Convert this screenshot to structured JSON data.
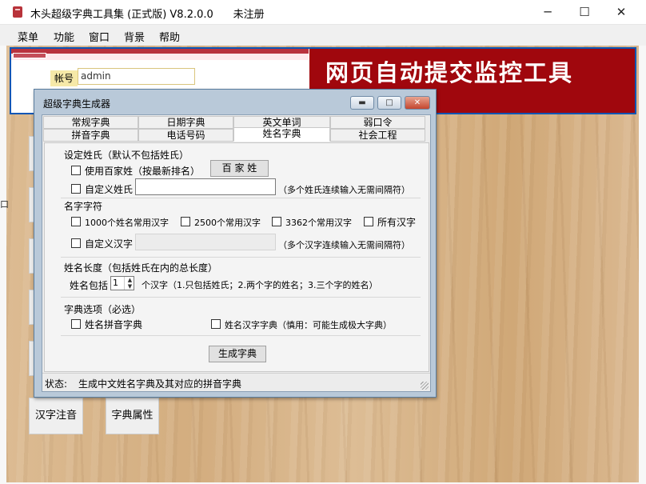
{
  "window": {
    "title": "木头超级字典工具集 (正式版) V8.2.0.0      未注册",
    "minimize": "─",
    "maximize": "☐",
    "close": "✕"
  },
  "menu": [
    "菜单",
    "功能",
    "窗口",
    "背景",
    "帮助"
  ],
  "web_preview": {
    "account_label": "帐号",
    "account_value": "admin",
    "banner_text": "网页自动提交监控工具"
  },
  "bottom_buttons": [
    "汉字注音",
    "字典属性"
  ],
  "edge_glyph": "口",
  "dialog": {
    "title": "超级字典生成器",
    "controls": {
      "minimize": "▬",
      "maximize": "□",
      "close": "✕"
    },
    "tabs_row1": [
      "常规字典",
      "日期字典",
      "英文单词",
      "弱口令"
    ],
    "tabs_row2": [
      "拼音字典",
      "电话号码",
      "姓名字典",
      "社会工程"
    ],
    "active_tab": "姓名字典",
    "surname": {
      "title": "设定姓氏（默认不包括姓氏）",
      "use_baijiaxing": "使用百家姓（按最新排名）",
      "baijiaxing_button": "百 家 姓",
      "custom_surname": "自定义姓氏",
      "custom_hint": "（多个姓氏连续输入无需间隔符）"
    },
    "chars": {
      "title": "名字字符",
      "opt1": "1000个姓名常用汉字",
      "opt2": "2500个常用汉字",
      "opt3": "3362个常用汉字",
      "opt4": "所有汉字",
      "custom_chars": "自定义汉字",
      "custom_hint": "（多个汉字连续输入无需间隔符）"
    },
    "length": {
      "title": "姓名长度（包括姓氏在内的总长度）",
      "prefix": "姓名包括",
      "value": "1",
      "suffix": "个汉字（1.只包括姓氏；2.两个字的姓名；3.三个字的姓名）"
    },
    "options": {
      "title": "字典选项（必选）",
      "pinyin": "姓名拼音字典",
      "hanzi": "姓名汉字字典（慎用：可能生成极大字典）"
    },
    "generate_button": "生成字典",
    "status_label": "状态:",
    "status_text": "生成中文姓名字典及其对应的拼音字典"
  }
}
